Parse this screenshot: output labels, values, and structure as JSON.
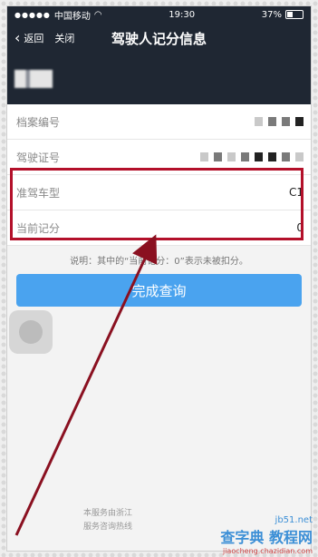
{
  "status": {
    "carrier": "中国移动",
    "time": "19:30",
    "battery": "37%",
    "battery_level": 0.37
  },
  "nav": {
    "back_label": "返回",
    "close_label": "关闭",
    "title": "驾驶人记分信息"
  },
  "rows": [
    {
      "label": "档案编号",
      "value": ""
    },
    {
      "label": "驾驶证号",
      "value": ""
    },
    {
      "label": "准驾车型",
      "value": "C1"
    },
    {
      "label": "当前记分",
      "value": "0"
    }
  ],
  "note": "说明：其中的“当前记分：0”表示未被扣分。",
  "button": "完成查询",
  "footer": {
    "line1": "本服务由浙江",
    "line2": "服务咨询热线"
  },
  "watermark": {
    "site": "jb51.net",
    "big": "查字典 教程网",
    "small": "jiaocheng.chazidian.com"
  },
  "colors": {
    "header_bg": "#1f2733",
    "button_bg": "#4aa3ef",
    "highlight": "#b3102a"
  }
}
